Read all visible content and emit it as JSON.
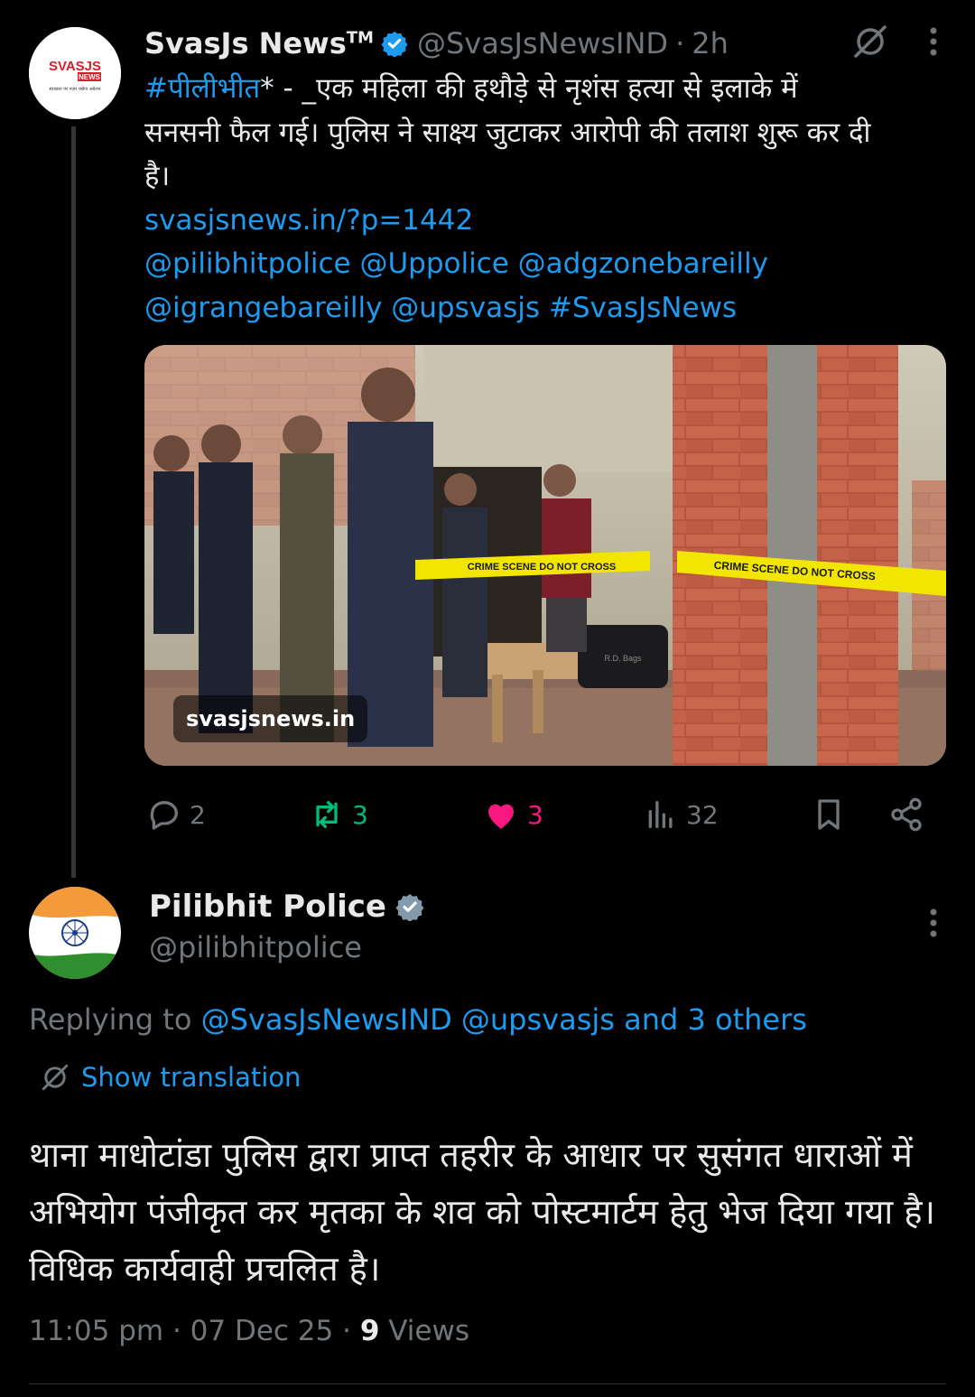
{
  "tweet": {
    "display_name": "SvasJs News",
    "trademark": "TM",
    "handle": "@SvasJsNewsIND",
    "separator": "·",
    "time": "2h",
    "hashtag": "#पीलीभीत",
    "text_line1_rest": "* - _एक महिला की हथौड़े से नृशंस हत्या से इलाके में",
    "text_line2": "सनसनी फैल गई। पुलिस ने साक्ष्य जुटाकर आरोपी की तलाश शुरू कर दी",
    "text_line3": "है।",
    "url": "svasjsnews.in/?p=1442",
    "mentions_line1": "@pilibhitpolice @Uppolice @adgzonebareilly",
    "mentions_line2": "@igrangebareilly @upsvasjs #SvasJsNews",
    "avatar_logo": "SVASJS",
    "avatar_logo_sub": "NEWS",
    "avatar_tagline": "स्वच्छता पर नज़र रखेगा अग्रेशन",
    "media_watermark": "svasjsnews.in",
    "tape_text": "CRIME SCENE DO NOT CROSS",
    "bag_label": "R.D. Bags",
    "stats": {
      "replies": "2",
      "reposts": "3",
      "likes": "3",
      "views": "32"
    }
  },
  "reply": {
    "display_name": "Pilibhit Police",
    "handle": "@pilibhitpolice",
    "replying_prefix": "Replying to",
    "replying_targets": "@SvasJsNewsIND @upsvasjs and 3 others",
    "translate_label": "Show translation",
    "body": "थाना माधोटांडा पुलिस द्वारा प्राप्त तहरीर के आधार पर सुसंगत धाराओं में अभियोग पंजीकृत कर मृतका के शव को पोस्टमार्टम हेतु भेज दिया गया है। विधिक कार्यवाही प्रचलित है।",
    "time": "11:05 pm",
    "date": "07 Dec 25",
    "views_count": "9",
    "views_label": "Views",
    "separator": "·"
  },
  "colors": {
    "background": "#000000",
    "text": "#e7e9ea",
    "muted": "#71767b",
    "link": "#1d9bf0",
    "repost": "#00ba7c",
    "like": "#f91880"
  },
  "icons": [
    "verified-badge-icon",
    "translate-icon",
    "more-icon",
    "reply-icon",
    "repost-icon",
    "like-icon",
    "views-icon",
    "bookmark-icon",
    "share-icon"
  ]
}
